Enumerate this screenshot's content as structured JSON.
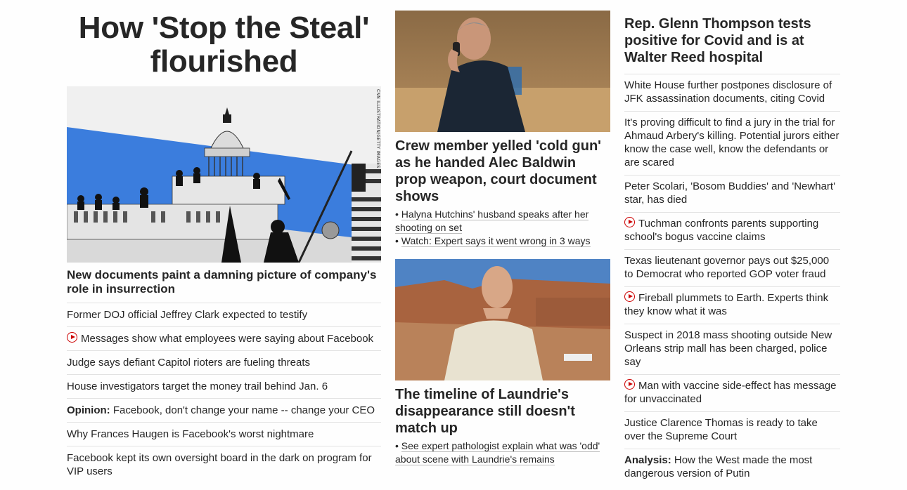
{
  "column_left": {
    "title": "How 'Stop the Steal' flourished",
    "image_credit": "CNN ILLUSTRATION/GETTY IMAGES",
    "lead_headline": "New documents paint a damning picture of company's role in insurrection",
    "items": [
      {
        "text": "Former DOJ official Jeffrey Clark expected to testify"
      },
      {
        "text": "Messages show what employees were saying about Facebook",
        "video": true
      },
      {
        "text": "Judge says defiant Capitol rioters are fueling threats"
      },
      {
        "text": "House investigators target the money trail behind Jan. 6"
      },
      {
        "prefix": "Opinion:",
        "text": " Facebook, don't change your name -- change your CEO"
      },
      {
        "text": "Why Frances Haugen is Facebook's worst nightmare"
      },
      {
        "text": "Facebook kept its own oversight board in the dark on program for VIP users"
      }
    ]
  },
  "column_middle": {
    "story1": {
      "headline": "Crew member yelled 'cold gun' as he handed Alec Baldwin prop weapon, court document shows",
      "links": [
        "Halyna Hutchins' husband speaks after her shooting on set",
        "Watch: Expert says it went wrong in 3 ways"
      ]
    },
    "story2": {
      "headline": "The timeline of Laundrie's disappearance still doesn't match up",
      "links": [
        "See expert pathologist explain what was 'odd' about scene with Laundrie's remains"
      ]
    }
  },
  "column_right": {
    "top_headline": "Rep. Glenn Thompson tests positive for Covid and is at Walter Reed hospital",
    "items": [
      {
        "text": "White House further postpones disclosure of JFK assassination documents, citing Covid"
      },
      {
        "text": "It's proving difficult to find a jury in the trial for Ahmaud Arbery's killing. Potential jurors either know the case well, know the defendants or are scared"
      },
      {
        "text": "Peter Scolari, 'Bosom Buddies' and 'Newhart' star, has died"
      },
      {
        "text": "Tuchman confronts parents supporting school's bogus vaccine claims",
        "video": true
      },
      {
        "text": "Texas lieutenant governor pays out $25,000 to Democrat who reported GOP voter fraud"
      },
      {
        "text": "Fireball plummets to Earth. Experts think they know what it was",
        "video": true
      },
      {
        "text": "Suspect in 2018 mass shooting outside New Orleans strip mall has been charged, police say"
      },
      {
        "text": "Man with vaccine side-effect has message for unvaccinated",
        "video": true
      },
      {
        "text": "Justice Clarence Thomas is ready to take over the Supreme Court"
      },
      {
        "prefix": "Analysis:",
        "text": " How the West made the most dangerous version of Putin"
      }
    ]
  },
  "colors": {
    "video_red": "#cc0000",
    "divider": "#e2e2e2",
    "text": "#262626",
    "illustration_blue": "#3b7ddd"
  }
}
